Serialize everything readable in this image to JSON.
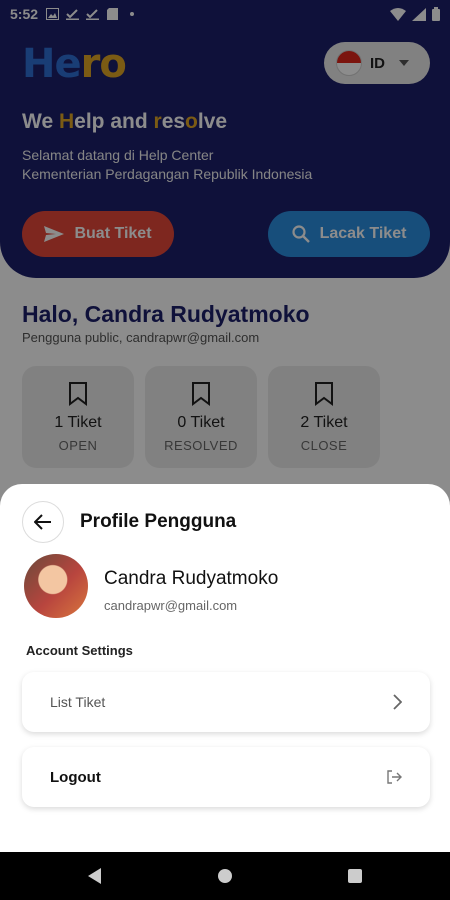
{
  "status_bar": {
    "time": "5:52"
  },
  "header": {
    "logo_text": "Hero",
    "language": "ID",
    "tagline": {
      "part1": "We ",
      "H": "H",
      "part2": "elp and ",
      "r": "r",
      "part3": "es",
      "o": "o",
      "part4": "lve"
    },
    "welcome_line1": "Selamat datang di Help Center",
    "welcome_line2": "Kementerian Perdagangan Republik Indonesia",
    "buat_tiket": "Buat Tiket",
    "lacak_tiket": "Lacak Tiket"
  },
  "dashboard": {
    "greeting": "Halo, Candra Rudyatmoko",
    "subtitle": "Pengguna public, candrapwr@gmail.com",
    "stats": [
      {
        "count": "1 Tiket",
        "label": "OPEN"
      },
      {
        "count": "0 Tiket",
        "label": "RESOLVED"
      },
      {
        "count": "2 Tiket",
        "label": "CLOSE"
      }
    ]
  },
  "sheet": {
    "title": "Profile Pengguna",
    "name": "Candra Rudyatmoko",
    "email": "candrapwr@gmail.com",
    "section_label": "Account Settings",
    "items": [
      {
        "label": "List Tiket"
      },
      {
        "label": "Logout"
      }
    ]
  },
  "colors": {
    "hero_bg": "#1d1f6b",
    "accent_yellow": "#e1a626",
    "buat_btn": "#e6483a",
    "lacak_btn": "#2b8fe0"
  }
}
